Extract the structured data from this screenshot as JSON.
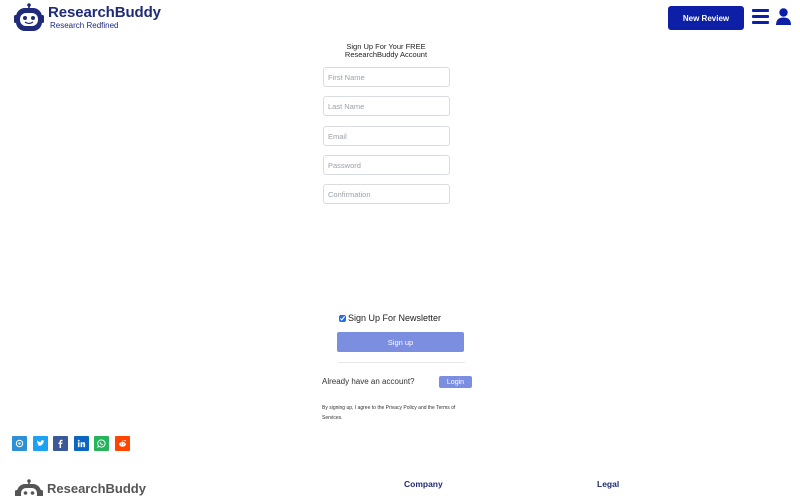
{
  "header": {
    "brand": "ResearchBuddy",
    "tagline": "Research Redfined",
    "new_review_label": "New Review",
    "menu_icon": "hamburger-menu-icon",
    "user_icon": "user-icon"
  },
  "form": {
    "title": "Sign Up For Your FREE ResearchBuddy Account",
    "first_name_placeholder": "First Name",
    "last_name_placeholder": "Last Name",
    "email_placeholder": "Email",
    "password_placeholder": "Password",
    "confirmation_placeholder": "Confirmation",
    "newsletter_label": "Sign Up For Newsletter",
    "newsletter_checked": true,
    "signup_label": "Sign up",
    "already_text": "Already have an account?",
    "login_label": "Login",
    "terms_text": "By signing up, I agree to the Privacy Policy and the Terms of Services."
  },
  "share": [
    {
      "name": "email",
      "icon": "email-icon",
      "color": "#2d8fd5"
    },
    {
      "name": "twitter",
      "icon": "twitter-icon",
      "color": "#1da1f2"
    },
    {
      "name": "facebook",
      "icon": "facebook-icon",
      "color": "#3b5998"
    },
    {
      "name": "linkedin",
      "icon": "linkedin-icon",
      "color": "#0a66c2"
    },
    {
      "name": "whatsapp",
      "icon": "whatsapp-icon",
      "color": "#25b45b"
    },
    {
      "name": "reddit",
      "icon": "reddit-icon",
      "color": "#ff4500"
    }
  ],
  "footer": {
    "brand": "ResearchBuddy",
    "company_heading": "Company",
    "legal_heading": "Legal"
  },
  "colors": {
    "primary": "#0d1fa6",
    "brand_text": "#1f2a7a",
    "button_light": "#7b8ee0"
  }
}
